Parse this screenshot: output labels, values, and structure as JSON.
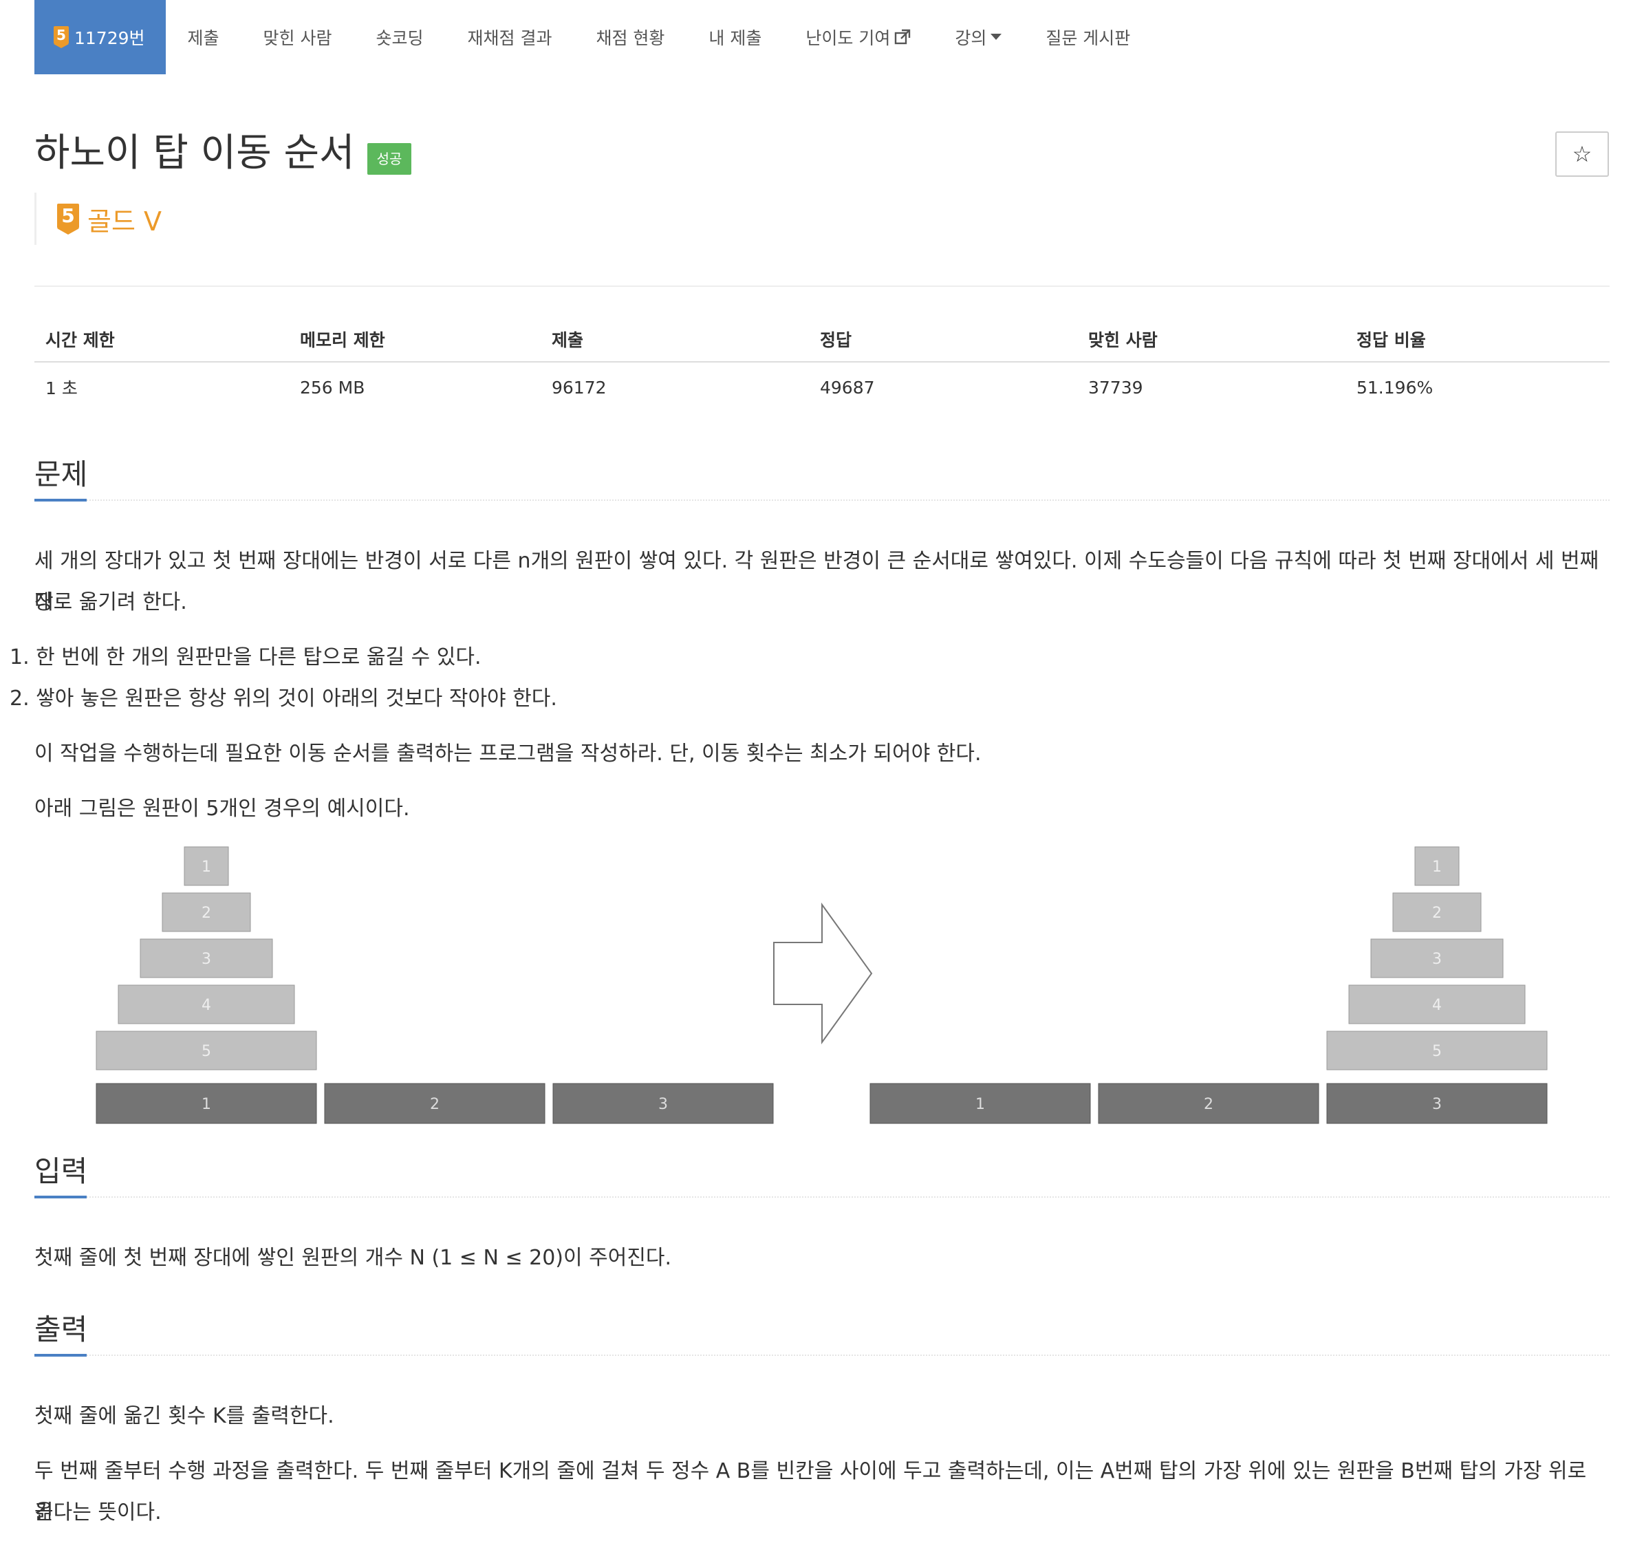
{
  "nav": {
    "problem": {
      "tier_num": "5",
      "label": "11729번"
    },
    "items": [
      "제출",
      "맞힌 사람",
      "숏코딩",
      "재채점 결과",
      "채점 현황",
      "내 제출",
      "난이도 기여",
      "강의",
      "질문 게시판"
    ],
    "ext_icon": "external-link-icon",
    "caret_icon": "caret-down-icon"
  },
  "problem": {
    "title": "하노이 탑 이동 순서",
    "status": "성공",
    "tier_num": "5",
    "tier": "골드 V",
    "star_icon": "☆"
  },
  "stats": {
    "headers": [
      "시간 제한",
      "메모리 제한",
      "제출",
      "정답",
      "맞힌 사람",
      "정답 비율"
    ],
    "values": [
      "1 초",
      "256 MB",
      "96172",
      "49687",
      "37739",
      "51.196%"
    ]
  },
  "sections": {
    "problem": {
      "title": "문제",
      "p1_line1": "세 개의 장대가 있고 첫 번째 장대에는 반경이 서로 다른 n개의 원판이 쌓여 있다. 각 원판은 반경이 큰 순서대로 쌓여있다. 이제 수도승들이 다음 규칙에 따라 첫 번째 장대에서 세 번째 장",
      "p1_line2": "대로 옮기려 한다.",
      "rules": [
        "1. 한 번에 한 개의 원판만을 다른 탑으로 옮길 수 있다.",
        "2. 쌓아 놓은 원판은 항상 위의 것이 아래의 것보다 작아야 한다."
      ],
      "p2": "이 작업을 수행하는데 필요한 이동 순서를 출력하는 프로그램을 작성하라. 단, 이동 횟수는 최소가 되어야 한다.",
      "p3": "아래 그림은 원판이 5개인 경우의 예시이다."
    },
    "input": {
      "title": "입력",
      "p1": "첫째 줄에 첫 번째 장대에 쌓인 원판의 개수 N (1 ≤ N ≤ 20)이 주어진다."
    },
    "output": {
      "title": "출력",
      "p1": "첫째 줄에 옮긴 횟수 K를 출력한다.",
      "p2_line1": "두 번째 줄부터 수행 과정을 출력한다. 두 번째 줄부터 K개의 줄에 걸쳐 두 정수 A B를 빈칸을 사이에 두고 출력하는데, 이는 A번째 탑의 가장 위에 있는 원판을 B번째 탑의 가장 위로 옮",
      "p2_line2": "긴다는 뜻이다."
    }
  },
  "figure": {
    "disks": [
      "1",
      "2",
      "3",
      "4",
      "5"
    ],
    "poles": [
      "1",
      "2",
      "3"
    ],
    "disk_color": "#c0c0c0",
    "pole_color": "#747474",
    "arrow_icon": "right-arrow-icon"
  }
}
